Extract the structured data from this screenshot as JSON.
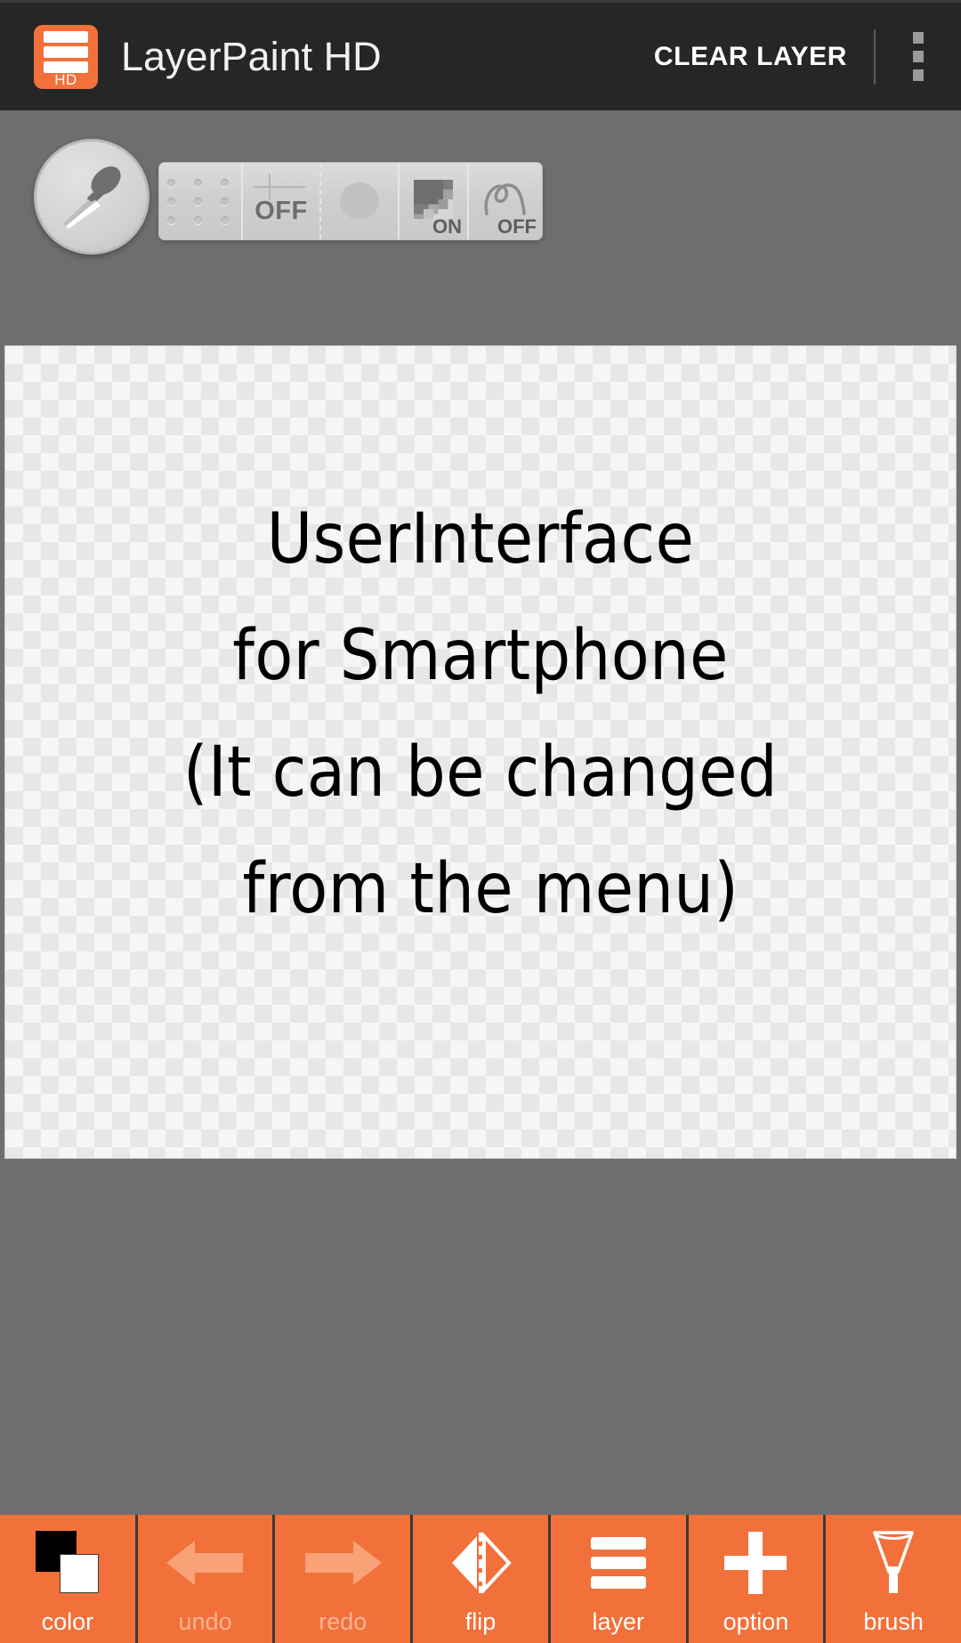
{
  "header": {
    "app_icon_name": "layerpaint-app-icon",
    "app_icon_badge": "HD",
    "title": "LayerPaint HD",
    "clear_layer_label": "CLEAR LAYER",
    "overflow_menu_name": "overflow-menu-icon",
    "background_color": "#262626",
    "accent_color": "#f2703a"
  },
  "workspace": {
    "background_color": "#6e6e6e",
    "picker_button": {
      "name": "eyedropper-button",
      "icon": "eyedropper-icon"
    },
    "mode_toolbar": {
      "cells": [
        {
          "name": "grid-dots-toggle",
          "icon": "grid-dots-icon",
          "label": ""
        },
        {
          "name": "crosshair-toggle",
          "icon": "crosshair-icon",
          "label": "OFF"
        },
        {
          "name": "blur-toggle",
          "icon": "blur-dot-icon",
          "label": ""
        },
        {
          "name": "antialias-toggle",
          "icon": "checker-gradient-icon",
          "label": "ON"
        },
        {
          "name": "stroke-correction-toggle",
          "icon": "stroke-curve-icon",
          "label": "OFF"
        }
      ]
    }
  },
  "canvas": {
    "name": "drawing-canvas",
    "transparent": true,
    "text_lines": [
      "UserInterface",
      "for Smartphone",
      "(It can be changed",
      " from the menu)"
    ],
    "text": "UserInterface\nfor Smartphone\n(It can be changed\n from the menu)"
  },
  "bottom_toolbar": {
    "background_color": "#f2703a",
    "buttons": [
      {
        "name": "color-button",
        "label": "color",
        "icon": "color-swatch-icon",
        "disabled": false
      },
      {
        "name": "undo-button",
        "label": "undo",
        "icon": "arrow-left-icon",
        "disabled": true
      },
      {
        "name": "redo-button",
        "label": "redo",
        "icon": "arrow-right-icon",
        "disabled": true
      },
      {
        "name": "flip-button",
        "label": "flip",
        "icon": "mirror-flip-icon",
        "disabled": false
      },
      {
        "name": "layer-button",
        "label": "layer",
        "icon": "layers-icon",
        "disabled": false
      },
      {
        "name": "option-button",
        "label": "option",
        "icon": "plus-icon",
        "disabled": false
      },
      {
        "name": "brush-button",
        "label": "brush",
        "icon": "brush-icon",
        "disabled": false
      }
    ]
  }
}
